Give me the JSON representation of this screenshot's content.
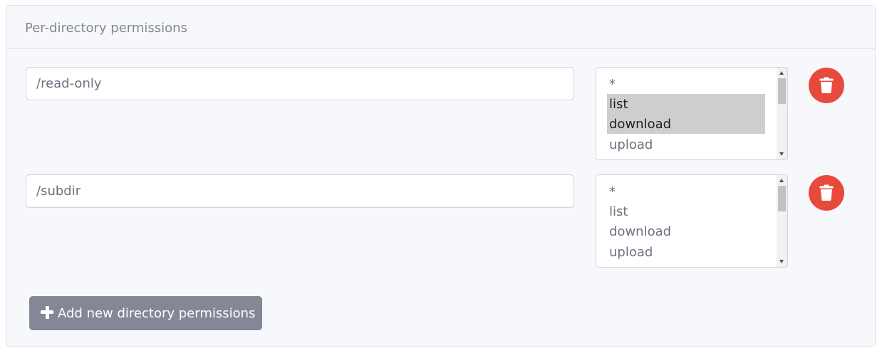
{
  "card": {
    "title": "Per-directory permissions"
  },
  "rows": [
    {
      "path": "/read-only",
      "options": [
        {
          "label": "*",
          "selected": false
        },
        {
          "label": "list",
          "selected": true
        },
        {
          "label": "download",
          "selected": true
        },
        {
          "label": "upload",
          "selected": false
        }
      ]
    },
    {
      "path": "/subdir",
      "options": [
        {
          "label": "*",
          "selected": false
        },
        {
          "label": "list",
          "selected": false
        },
        {
          "label": "download",
          "selected": false
        },
        {
          "label": "upload",
          "selected": false
        }
      ]
    }
  ],
  "add_button": {
    "label": "Add new directory permissions",
    "icon": "plus-icon"
  },
  "delete_button": {
    "icon": "trash-icon"
  },
  "colors": {
    "danger": "#e74a3b",
    "secondary": "#858796",
    "selected_option": "#cecece"
  }
}
